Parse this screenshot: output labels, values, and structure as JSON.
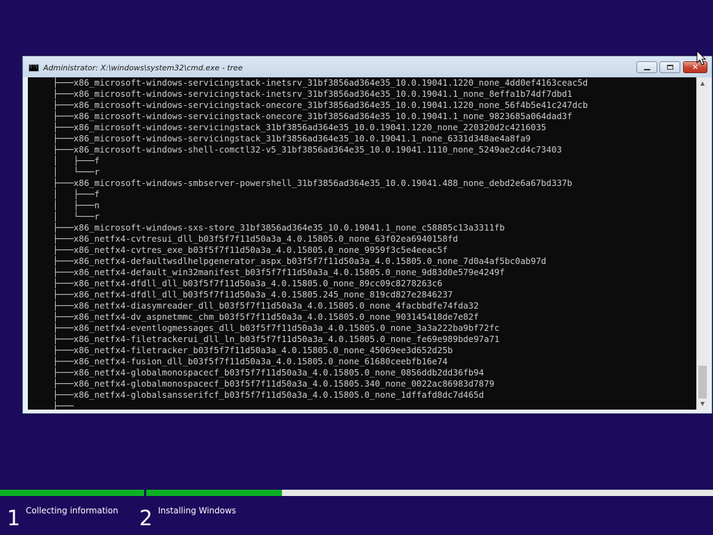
{
  "window": {
    "title": "Administrator: X:\\windows\\system32\\cmd.exe - tree",
    "buttons": {
      "minimize": "minimize-icon",
      "maximize": "maximize-icon",
      "close": "✕"
    }
  },
  "console": {
    "lines": [
      "    ├───x86_microsoft-windows-servicingstack-inetsrv_31bf3856ad364e35_10.0.19041.1220_none_4dd0ef4163ceac5d",
      "    ├───x86_microsoft-windows-servicingstack-inetsrv_31bf3856ad364e35_10.0.19041.1_none_8effa1b74df7dbd1",
      "    ├───x86_microsoft-windows-servicingstack-onecore_31bf3856ad364e35_10.0.19041.1220_none_56f4b5e41c247dcb",
      "    ├───x86_microsoft-windows-servicingstack-onecore_31bf3856ad364e35_10.0.19041.1_none_9823685a064dad3f",
      "    ├───x86_microsoft-windows-servicingstack_31bf3856ad364e35_10.0.19041.1220_none_220320d2c4216035",
      "    ├───x86_microsoft-windows-servicingstack_31bf3856ad364e35_10.0.19041.1_none_6331d348ae4a8fa9",
      "    ├───x86_microsoft-windows-shell-comctl32-v5_31bf3856ad364e35_10.0.19041.1110_none_5249ae2cd4c73403",
      "    │   ├───f",
      "    │   └───r",
      "    ├───x86_microsoft-windows-smbserver-powershell_31bf3856ad364e35_10.0.19041.488_none_debd2e6a67bd337b",
      "    │   ├───f",
      "    │   ├───n",
      "    │   └───r",
      "    ├───x86_microsoft-windows-sxs-store_31bf3856ad364e35_10.0.19041.1_none_c58885c13a3311fb",
      "    ├───x86_netfx4-cvtresui_dll_b03f5f7f11d50a3a_4.0.15805.0_none_63f02ea6940158fd",
      "    ├───x86_netfx4-cvtres_exe_b03f5f7f11d50a3a_4.0.15805.0_none_9959f3c5e4eeac5f",
      "    ├───x86_netfx4-defaultwsdlhelpgenerator_aspx_b03f5f7f11d50a3a_4.0.15805.0_none_7d0a4af5bc0ab97d",
      "    ├───x86_netfx4-default_win32manifest_b03f5f7f11d50a3a_4.0.15805.0_none_9d83d0e579e4249f",
      "    ├───x86_netfx4-dfdll_dll_b03f5f7f11d50a3a_4.0.15805.0_none_89cc09c8278263c6",
      "    ├───x86_netfx4-dfdll_dll_b03f5f7f11d50a3a_4.0.15805.245_none_819cd827e2846237",
      "    ├───x86_netfx4-diasymreader_dll_b03f5f7f11d50a3a_4.0.15805.0_none_4facbbdfe74fda32",
      "    ├───x86_netfx4-dv_aspnetmmc_chm_b03f5f7f11d50a3a_4.0.15805.0_none_903145418de7e82f",
      "    ├───x86_netfx4-eventlogmessages_dll_b03f5f7f11d50a3a_4.0.15805.0_none_3a3a222ba9bf72fc",
      "    ├───x86_netfx4-filetrackerui_dll_ln_b03f5f7f11d50a3a_4.0.15805.0_none_fe69e989bde97a71",
      "    ├───x86_netfx4-filetracker_b03f5f7f11d50a3a_4.0.15805.0_none_45069ee3d652d25b",
      "    ├───x86_netfx4-fusion_dll_b03f5f7f11d50a3a_4.0.15805.0_none_61680ceebfb16e74",
      "    ├───x86_netfx4-globalmonospacecf_b03f5f7f11d50a3a_4.0.15805.0_none_0856ddb2dd36fb94",
      "    ├───x86_netfx4-globalmonospacecf_b03f5f7f11d50a3a_4.0.15805.340_none_0022ac86983d7879",
      "    ├───x86_netfx4-globalsansserifcf_b03f5f7f11d50a3a_4.0.15805.0_none_1dffafd8dc7d465d",
      "    ├───"
    ]
  },
  "scrollbar": {
    "up": "▲",
    "down": "▼",
    "position": 0.92
  },
  "setup": {
    "steps": [
      {
        "number": "1",
        "label": "Collecting information",
        "progress": 1.0
      },
      {
        "number": "2",
        "label": "Installing Windows",
        "progress": 0.24
      }
    ]
  },
  "colors": {
    "desktop": "#1c0a5c",
    "console_bg": "#0c0c0c",
    "console_text": "#cccccc",
    "progress_fill": "#0cb025",
    "progress_track": "#e6e6e6"
  }
}
